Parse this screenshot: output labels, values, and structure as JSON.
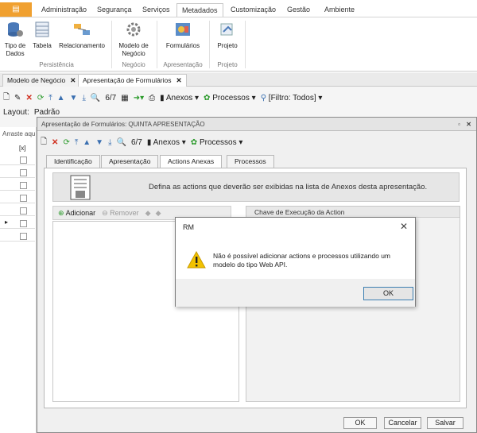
{
  "ribbon_tabs": [
    "Administração",
    "Segurança",
    "Serviços",
    "Metadados",
    "Customização",
    "Gestão",
    "Ambiente"
  ],
  "ribbon": {
    "buttons": [
      {
        "label": "Tipo de\nDados"
      },
      {
        "label": "Tabela"
      },
      {
        "label": "Relacionamento"
      },
      {
        "label": "Modelo de\nNegócio"
      },
      {
        "label": "Formulários"
      },
      {
        "label": "Projeto"
      }
    ],
    "groups": [
      "Persistência",
      "Negócio",
      "Apresentação",
      "Projeto"
    ]
  },
  "doc_tabs": [
    {
      "label": "Modelo de Negócio"
    },
    {
      "label": "Apresentação de Formulários"
    }
  ],
  "main_toolbar": {
    "counter": "6/7",
    "anexos": "Anexos",
    "processos": "Processos",
    "filter": "[Filtro: Todos]"
  },
  "layout_bar": {
    "label": "Layout:",
    "value": "Padrão"
  },
  "left_grid": {
    "group_hint": "Arraste aqu",
    "header_col": "[x]"
  },
  "inner_window": {
    "title": "Apresentação de Formulários: QUINTA APRESENTAÇÃO",
    "counter": "6/7",
    "anexos": "Anexos",
    "processos": "Processos",
    "tabs": [
      "Identificação",
      "Apresentação",
      "Actions Anexas",
      "Processos"
    ],
    "banner_text": "Defina as actions que deverão ser exibidas na lista de Anexos desta apresentação.",
    "add_label": "Adicionar",
    "remove_label": "Remover",
    "grid_column": "Chave de Execução da Action",
    "ok": "OK",
    "cancel": "Cancelar",
    "save": "Salvar"
  },
  "dialog": {
    "title": "RM",
    "message": "Não é possível adicionar actions e processos utilizando um modelo do tipo Web API.",
    "ok": "OK"
  },
  "colors": {
    "app_button": "#f0a030",
    "warning": "#f2c200",
    "dialog_border": "#3c7fb1"
  }
}
